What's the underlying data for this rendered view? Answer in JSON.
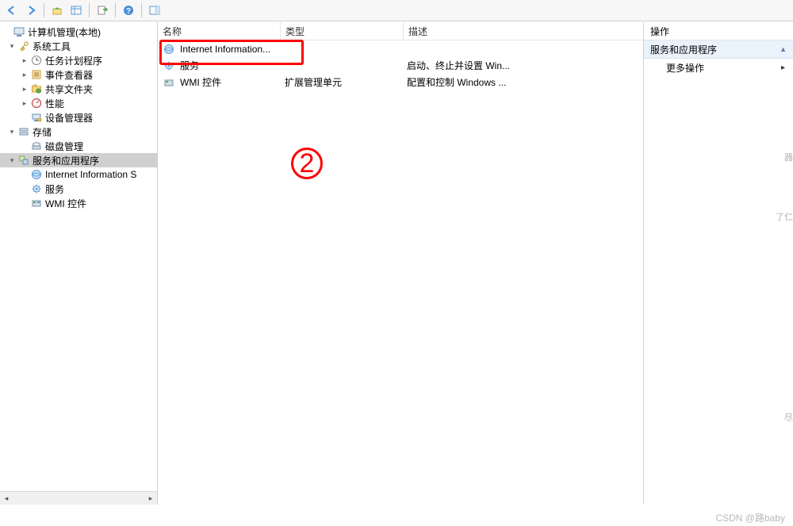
{
  "tree_root": "计算机管理(本地)",
  "tree": {
    "system_tools": "系统工具",
    "task_scheduler": "任务计划程序",
    "event_viewer": "事件查看器",
    "shared_folders": "共享文件夹",
    "performance": "性能",
    "device_manager": "设备管理器",
    "storage": "存储",
    "disk_management": "磁盘管理",
    "services_apps": "服务和应用程序",
    "iis": "Internet Information S",
    "services": "服务",
    "wmi": "WMI 控件"
  },
  "columns": {
    "name": "名称",
    "type": "类型",
    "desc": "描述"
  },
  "list": {
    "iis": {
      "name": "Internet Information..."
    },
    "services": {
      "name": "服务",
      "desc": "启动、终止并设置 Win..."
    },
    "wmi": {
      "name": "WMI 控件",
      "type": "扩展管理单元",
      "desc": "配置和控制 Windows ..."
    }
  },
  "actions": {
    "title": "操作",
    "category": "服务和应用程序",
    "more": "更多操作"
  },
  "annotation": {
    "num": "2"
  },
  "edge_text": {
    "a": "器",
    "b": "了仁",
    "c": "尽"
  },
  "watermark": "CSDN @路baby"
}
